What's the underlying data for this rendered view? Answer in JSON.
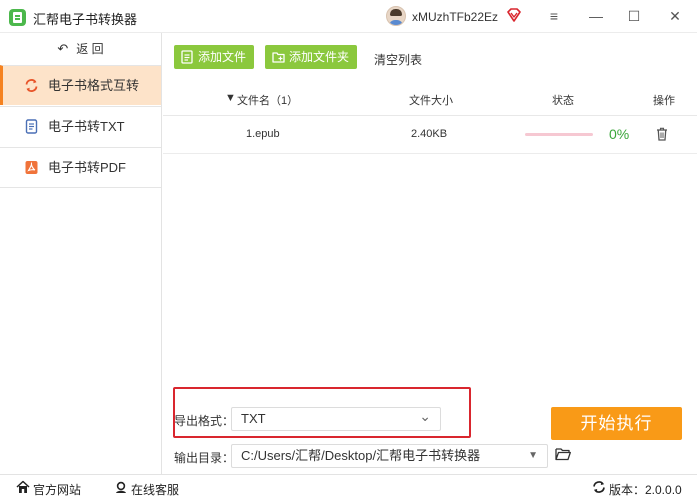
{
  "window": {
    "title": "汇帮电子书转换器",
    "username": "xMUzhTFb22Ez",
    "menu_glyph": "≡",
    "minimize_glyph": "—",
    "maximize_glyph": "☐",
    "close_glyph": "✕"
  },
  "sidebar": {
    "back_arrow": "↶",
    "back_label": "返 回",
    "items": [
      {
        "label": "电子书格式互转",
        "active": true
      },
      {
        "label": "电子书转TXT",
        "active": false
      },
      {
        "label": "电子书转PDF",
        "active": false
      }
    ]
  },
  "toolbar": {
    "add_file": "添加文件",
    "add_folder": "添加文件夹",
    "clear_list": "清空列表"
  },
  "table": {
    "sort_glyph": "▼",
    "headers": {
      "name": "文件名（1）",
      "size": "文件大小",
      "status": "状态",
      "action": "操作"
    },
    "rows": [
      {
        "name": "1.epub",
        "size": "2.40KB",
        "progress": 0,
        "percent_label": "0%"
      }
    ]
  },
  "config": {
    "export_format_label": "导出格式：",
    "export_format_value": "TXT",
    "output_dir_label": "输出目录：",
    "output_dir_value": "C:/Users/汇帮/Desktop/汇帮电子书转换器",
    "chevron_glyph": "⌄",
    "dropdown_glyph": "▼",
    "start_button": "开始执行"
  },
  "statusbar": {
    "website": "官方网站",
    "support": "在线客服",
    "version": "版本：2.0.0.0"
  },
  "colors": {
    "accent_green": "#8bc83d",
    "accent_orange": "#f99a17",
    "active_nav_bg": "#fde3c9",
    "highlight_red": "#d9262e",
    "progress_green": "#3aa63a"
  }
}
